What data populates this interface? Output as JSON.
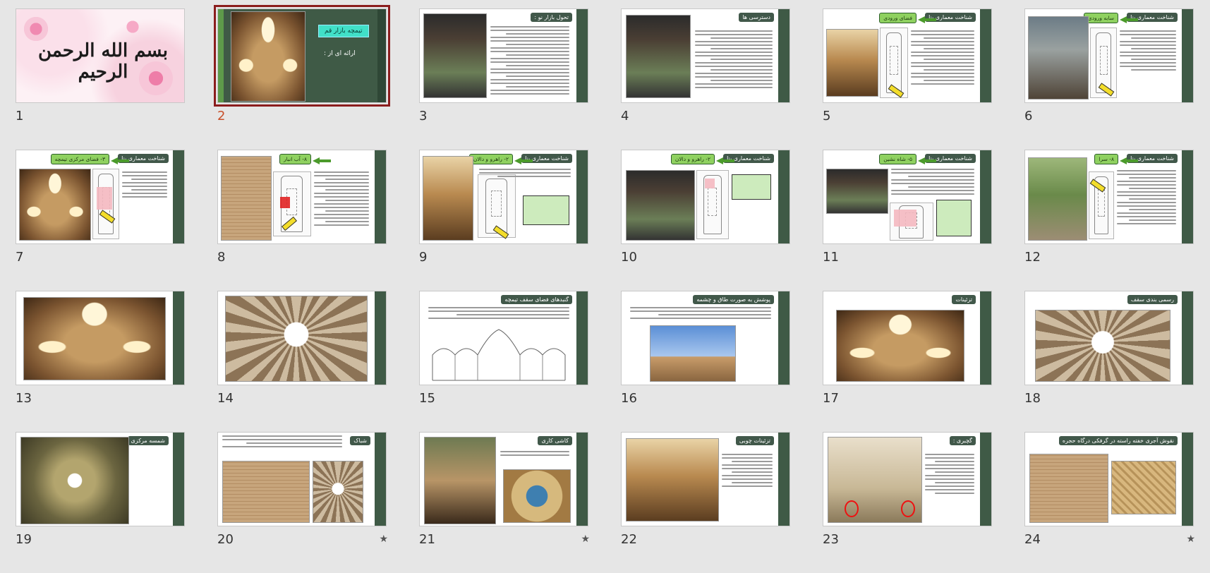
{
  "slides": [
    {
      "n": "1",
      "calligraphy": "بسم الله الرحمن الرحیم"
    },
    {
      "n": "2",
      "title": "تیمچه بازار قم",
      "subtitle": "ارائه ای از :"
    },
    {
      "n": "3",
      "title": "تحول بازار نو :"
    },
    {
      "n": "4",
      "title": "دسترسی ها"
    },
    {
      "n": "5",
      "title": "شناخت معماری بنا",
      "sub": "فضای ورودی"
    },
    {
      "n": "6",
      "title": "شناخت معماری بنا",
      "sub": "سابه ورودی"
    },
    {
      "n": "7",
      "title": "شناخت معماری بنا",
      "sub": "۳- فضای مرکزی تیمچه"
    },
    {
      "n": "8",
      "title": "",
      "sub": "۸- آب انبار"
    },
    {
      "n": "9",
      "title": "شناخت معماری بنا",
      "sub": "۲- راهرو و دالان"
    },
    {
      "n": "10",
      "title": "شناخت معماری بنا",
      "sub": "۲- راهرو و دالان"
    },
    {
      "n": "11",
      "title": "شناخت معماری بنا",
      "sub": "۵- شاه نشین"
    },
    {
      "n": "12",
      "title": "شناخت معماری بنا",
      "sub": "۸- سرا"
    },
    {
      "n": "13"
    },
    {
      "n": "14"
    },
    {
      "n": "15",
      "title": "گنبدهای فضای سقف تیمچه"
    },
    {
      "n": "16",
      "title": "پوشش به صورت طاق و چشمه"
    },
    {
      "n": "17",
      "title": "تزئینات"
    },
    {
      "n": "18",
      "title": "رسمی بندی سقف"
    },
    {
      "n": "19",
      "title": "شمسه مرکزی"
    },
    {
      "n": "20",
      "title": "شباک"
    },
    {
      "n": "21",
      "title": "کاشی کاری"
    },
    {
      "n": "22",
      "title": "تزئینات چوبی"
    },
    {
      "n": "23",
      "title": "گچبری :"
    },
    {
      "n": "24",
      "title": "نقوش آجری خفته راسته در گرفکی درگاه حجره"
    }
  ],
  "selected_slide": "2",
  "star_glyph": "★"
}
